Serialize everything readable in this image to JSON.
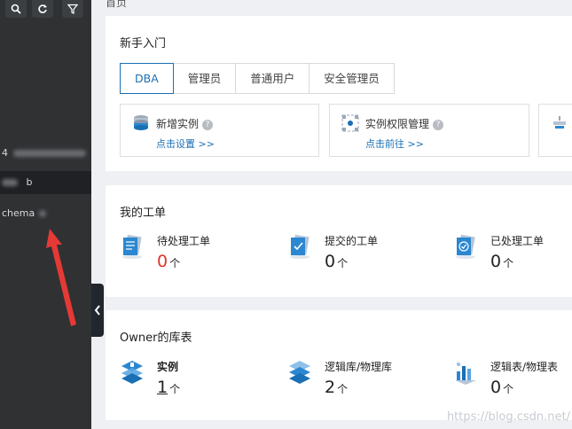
{
  "sidebar": {
    "tools": [
      {
        "name": "search-icon"
      },
      {
        "name": "refresh-icon"
      },
      {
        "name": "filter-icon"
      }
    ],
    "items": [
      {
        "label": "4"
      },
      {
        "label": "b"
      },
      {
        "label": "chema"
      }
    ]
  },
  "breadcrumb": "首页",
  "getting_started": {
    "title": "新手入门",
    "tabs": [
      "DBA",
      "管理员",
      "普通用户",
      "安全管理员"
    ],
    "active_tab": "DBA",
    "cards": [
      {
        "title": "新增实例",
        "link": "点击设置 >>",
        "icon": "database-stack-icon"
      },
      {
        "title": "实例权限管理",
        "link": "点击前往 >>",
        "icon": "permission-grid-icon"
      }
    ]
  },
  "my_tickets": {
    "title": "我的工单",
    "items": [
      {
        "label": "待处理工单",
        "value": "0",
        "unit": "个",
        "icon": "pending-ticket-icon"
      },
      {
        "label": "提交的工单",
        "value": "0",
        "unit": "个",
        "icon": "submitted-ticket-icon"
      },
      {
        "label": "已处理工单",
        "value": "0",
        "unit": "个",
        "icon": "processed-ticket-icon"
      }
    ]
  },
  "owner_tables": {
    "title": "Owner的库表",
    "items": [
      {
        "label": "实例",
        "value": "1",
        "unit": "个",
        "icon": "instance-stack-icon"
      },
      {
        "label": "逻辑库/物理库",
        "value": "2",
        "unit": "个",
        "icon": "database-layers-icon"
      },
      {
        "label": "逻辑表/物理表",
        "value": "0",
        "unit": "个",
        "icon": "table-chart-icon"
      }
    ]
  },
  "watermark": "https://blog.csdn.net/",
  "colors": {
    "accent": "#1a6fb5",
    "alert": "#e0342a",
    "sidebar": "#2f3133",
    "annotation": "#e53935"
  }
}
